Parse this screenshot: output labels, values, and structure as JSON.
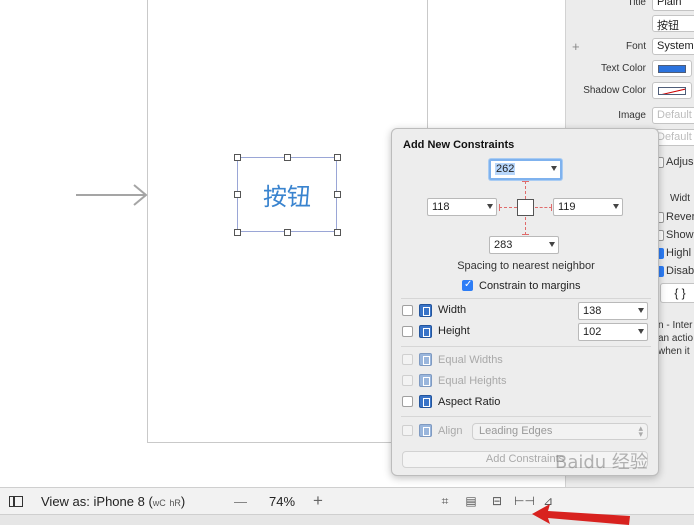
{
  "canvas": {
    "button_title": "按钮"
  },
  "inspector": {
    "title_label": "Title",
    "title_value": "Plain",
    "text_value": "按钮",
    "font_label": "Font",
    "font_value": "System",
    "text_color_label": "Text Color",
    "shadow_color_label": "Shadow Color",
    "image_label": "Image",
    "image_placeholder": "Default",
    "bg_placeholder": "Default",
    "adjust_label": "Adjus",
    "width_label": "Widt",
    "options": [
      "Rever",
      "Show",
      "Highl",
      "Disab"
    ],
    "braces": "{ }",
    "hint_lines": [
      "n - Inter",
      "an actio",
      "when it"
    ],
    "text_color_hex": "#2b73de"
  },
  "popover": {
    "title": "Add New Constraints",
    "top": "262",
    "left": "118",
    "right": "119",
    "bottom": "283",
    "spacing_caption": "Spacing to nearest neighbor",
    "constrain_margins_label": "Constrain to margins",
    "constrain_margins_checked": true,
    "width_label": "Width",
    "width_value": "138",
    "height_label": "Height",
    "height_value": "102",
    "equal_widths_label": "Equal Widths",
    "equal_heights_label": "Equal Heights",
    "aspect_ratio_label": "Aspect Ratio",
    "align_label": "Align",
    "align_value": "Leading Edges",
    "add_button_label": "Add Constraints"
  },
  "bottom_bar": {
    "view_as_prefix": "View as: iPhone 8 (",
    "wc": "wC",
    "hr": "hR",
    "view_as_suffix": ")",
    "zoom_minus": "—",
    "zoom": "74%",
    "zoom_plus": "+"
  },
  "watermark": "Baidu 经验"
}
